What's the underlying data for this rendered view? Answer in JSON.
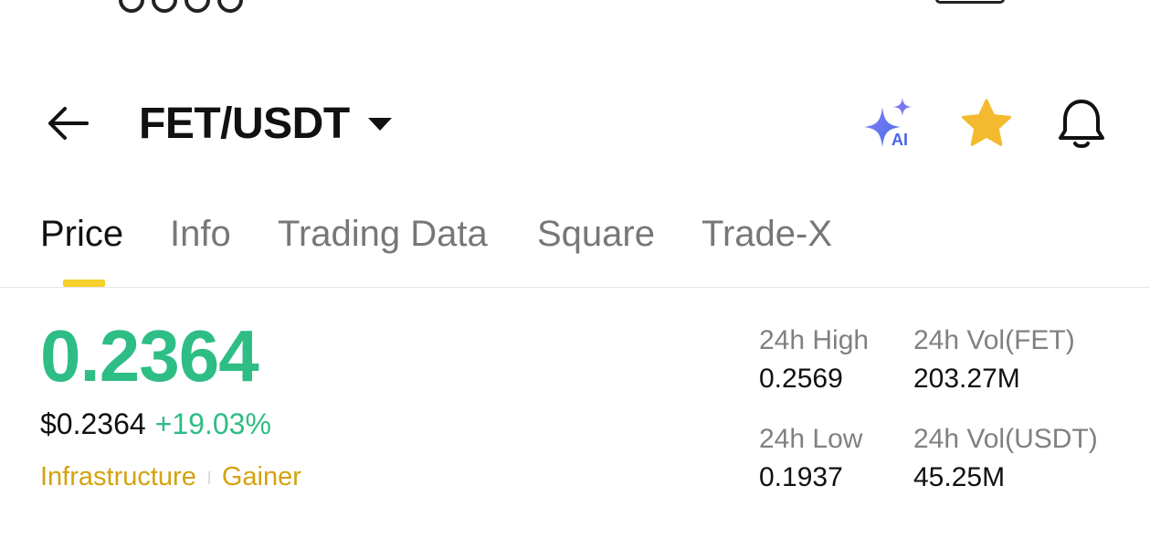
{
  "header": {
    "pair": "FET/USDT",
    "icons": {
      "back": "arrow-left-icon",
      "dropdown": "chevron-down-icon",
      "ai": "ai-sparkle-icon",
      "favorite": "star-icon",
      "alert": "bell-icon"
    },
    "ai_badge": "AI"
  },
  "tabs": [
    {
      "label": "Price",
      "active": true
    },
    {
      "label": "Info",
      "active": false
    },
    {
      "label": "Trading Data",
      "active": false
    },
    {
      "label": "Square",
      "active": false
    },
    {
      "label": "Trade-X",
      "active": false
    }
  ],
  "price": {
    "last": "0.2364",
    "usd": "$0.2364",
    "change": "+19.03%"
  },
  "tags": [
    "Infrastructure",
    "Gainer"
  ],
  "stats": {
    "high_label": "24h High",
    "high_value": "0.2569",
    "low_label": "24h Low",
    "low_value": "0.1937",
    "vol_base_label": "24h Vol(FET)",
    "vol_base_value": "203.27M",
    "vol_quote_label": "24h Vol(USDT)",
    "vol_quote_value": "45.25M"
  },
  "colors": {
    "up": "#2ebd85",
    "accent": "#f5cf2a",
    "tag": "#d4a20c",
    "star": "#f3ba2f",
    "ai": "#6d6cf0"
  }
}
